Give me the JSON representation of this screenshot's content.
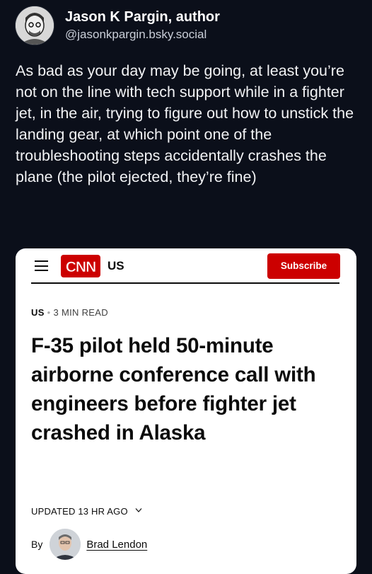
{
  "post": {
    "author_name": "Jason K Pargin, author",
    "author_handle": "@jasonkpargin.bsky.social",
    "text": "As bad as your day may be going, at least you’re not on the line with tech support while in a fighter jet, in the air, trying to figure out how to unstick the landing gear, at which point one of the troubleshooting steps accidentally crashes the plane (the pilot ejected, they’re fine)"
  },
  "article": {
    "logo_text": "CNN",
    "edition": "US",
    "subscribe_label": "Subscribe",
    "section": "US",
    "read_time": "3 MIN READ",
    "headline": "F-35 pilot held 50-minute airborne conference call with engineers before fighter jet crashed in Alaska",
    "updated": "UPDATED 13 HR AGO",
    "by_label": "By",
    "author": "Brad Lendon"
  },
  "colors": {
    "background": "#0b0f1a",
    "card": "#ffffff",
    "brand_red": "#cc0000"
  },
  "icons": [
    "hamburger-menu-icon",
    "chevron-down-icon",
    "cnn-logo"
  ]
}
